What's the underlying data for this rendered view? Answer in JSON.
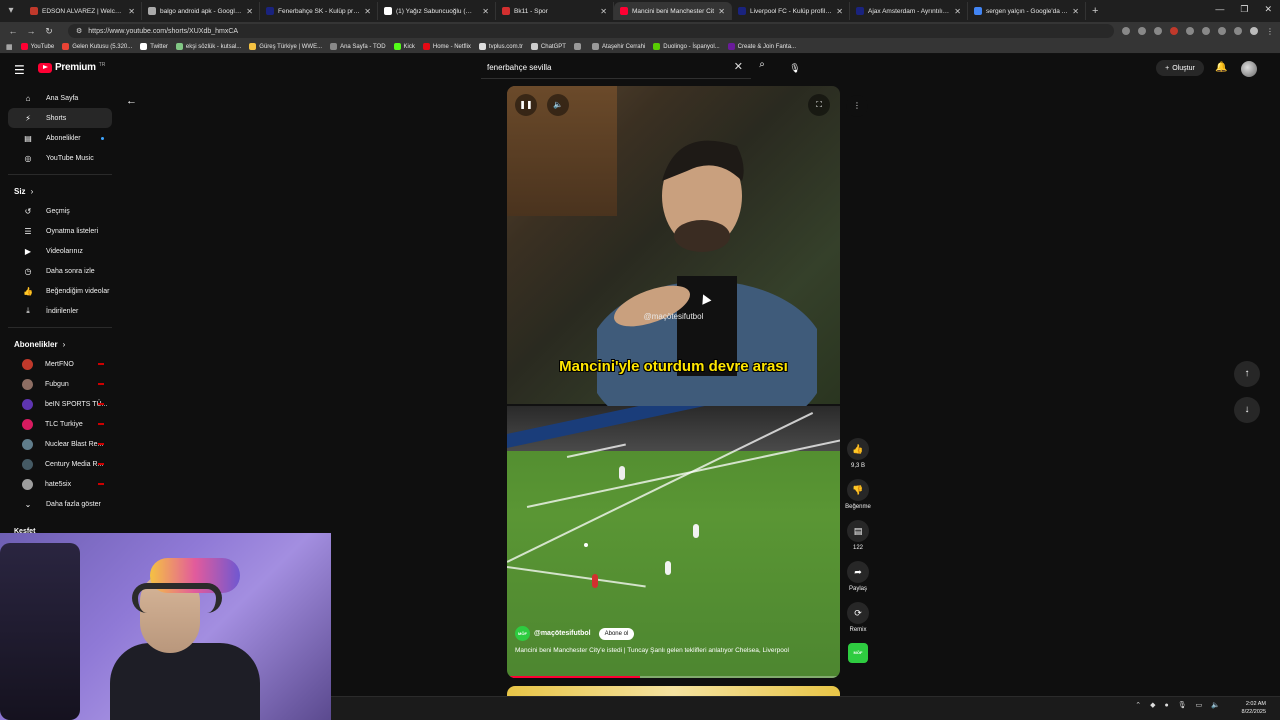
{
  "browser": {
    "tabs": [
      {
        "title": "EDSON ALVAREZ | Welcome To F",
        "favicon_color": "#c0392b"
      },
      {
        "title": "balgo android apk - Google'da A",
        "favicon_color": "#aaaaaa"
      },
      {
        "title": "Fenerbahçe SK - Kulüp profili | Tra",
        "favicon_color": "#1a237e"
      },
      {
        "title": "(1) Yağız Sabuncuoğlu (@yegosa",
        "favicon_color": "#ffffff"
      },
      {
        "title": "Bk11 - Spor",
        "favicon_color": "#d32f2f"
      },
      {
        "title": "Mancini beni Manchester Cit",
        "favicon_color": "#ff0033"
      },
      {
        "title": "Liverpool FC - Kulüp profili 17/18",
        "favicon_color": "#1a237e"
      },
      {
        "title": "Ajax Amsterdam - Ayrıntılı kadro",
        "favicon_color": "#1a237e"
      },
      {
        "title": "sergen yalçın - Google'da Ara",
        "favicon_color": "#4285f4"
      }
    ],
    "active_tab_index": 5,
    "url": "https://www.youtube.com/shorts/XUXdb_hmxCA",
    "bookmarks": [
      {
        "label": "YouTube",
        "color": "#ff0033"
      },
      {
        "label": "Gelen Kutusu (5.320...",
        "color": "#ea4335"
      },
      {
        "label": "Twitter",
        "color": "#ffffff"
      },
      {
        "label": "ekşi sözlük - kutsal...",
        "color": "#81c784"
      },
      {
        "label": "Güreş Türkiye | WWE...",
        "color": "#f5c242"
      },
      {
        "label": "Ana Sayfa - TOD",
        "color": "#888888"
      },
      {
        "label": "Kick",
        "color": "#53fc18"
      },
      {
        "label": "Home - Netflix",
        "color": "#e50914"
      },
      {
        "label": "tvplus.com.tr",
        "color": "#dddddd"
      },
      {
        "label": "ChatGPT",
        "color": "#cccccc"
      },
      {
        "label": "",
        "color": "#999999"
      },
      {
        "label": "Ataşehir Cerrahi",
        "color": "#999999"
      },
      {
        "label": "Duolingo - İspanyol...",
        "color": "#58cc02"
      },
      {
        "label": "Create & Join Fanta...",
        "color": "#6a1b9a"
      }
    ]
  },
  "youtube": {
    "logo_text": "Premium",
    "logo_tr": "TR",
    "search_value": "fenerbahçe sevilla",
    "create_label": "Oluştur",
    "sidebar": {
      "main": [
        {
          "label": "Ana Sayfa",
          "icon": "home-icon",
          "glyph": "⌂"
        },
        {
          "label": "Shorts",
          "icon": "shorts-icon",
          "glyph": "⚡"
        },
        {
          "label": "Abonelikler",
          "icon": "subscriptions-icon",
          "glyph": "▤"
        },
        {
          "label": "YouTube Music",
          "icon": "music-icon",
          "glyph": "◎"
        }
      ],
      "siz_title": "Siz",
      "siz": [
        {
          "label": "Geçmiş",
          "icon": "history-icon",
          "glyph": "↺"
        },
        {
          "label": "Oynatma listeleri",
          "icon": "playlist-icon",
          "glyph": "☰"
        },
        {
          "label": "Videolarınız",
          "icon": "your-videos-icon",
          "glyph": "▶"
        },
        {
          "label": "Daha sonra izle",
          "icon": "watch-later-icon",
          "glyph": "◷"
        },
        {
          "label": "Beğendiğim videolar",
          "icon": "liked-icon",
          "glyph": "👍"
        },
        {
          "label": "İndirilenler",
          "icon": "download-icon",
          "glyph": "⤓"
        }
      ],
      "subs_title": "Abonelikler",
      "subs": [
        {
          "label": "MertFNO",
          "color": "#c0392b"
        },
        {
          "label": "Fubgun",
          "color": "#8d6e63"
        },
        {
          "label": "beIN SPORTS TÜ...",
          "color": "#5e35b1"
        },
        {
          "label": "TLC Turkiye",
          "color": "#d81b60"
        },
        {
          "label": "Nuclear Blast Re...",
          "color": "#607d8b"
        },
        {
          "label": "Century Media R...",
          "color": "#455a64"
        },
        {
          "label": "hate5six",
          "color": "#9e9e9e"
        }
      ],
      "more_label": "Daha fazla göster",
      "kesfet": "Keşfet"
    },
    "short": {
      "watermark": "@maçötesifutbol",
      "subtitle": "Mancini'yle oturdum devre arası",
      "channel": "@maçötesifutbol",
      "channel_avatar_text": "MÖF",
      "subscribe_label": "Abone ol",
      "title": "Mancini beni Manchester City'e istedi | Tuncay Şanlı gelen teklifleri anlatıyor Chelsea, Liverpool",
      "progress": 0.4
    },
    "actions": [
      {
        "name": "like-button",
        "icon": "like-icon",
        "glyph": "👍",
        "label": "9,3 B"
      },
      {
        "name": "dislike-button",
        "icon": "dislike-icon",
        "glyph": "👎",
        "label": "Beğenme"
      },
      {
        "name": "comments-button",
        "icon": "comment-icon",
        "glyph": "▤",
        "label": "122"
      },
      {
        "name": "share-button",
        "icon": "share-icon",
        "glyph": "➦",
        "label": "Paylaş"
      },
      {
        "name": "remix-button",
        "icon": "remix-icon",
        "glyph": "⟳",
        "label": "Remix"
      }
    ]
  },
  "taskbar": {
    "time": "2:02 AM",
    "date": "8/22/2025"
  }
}
